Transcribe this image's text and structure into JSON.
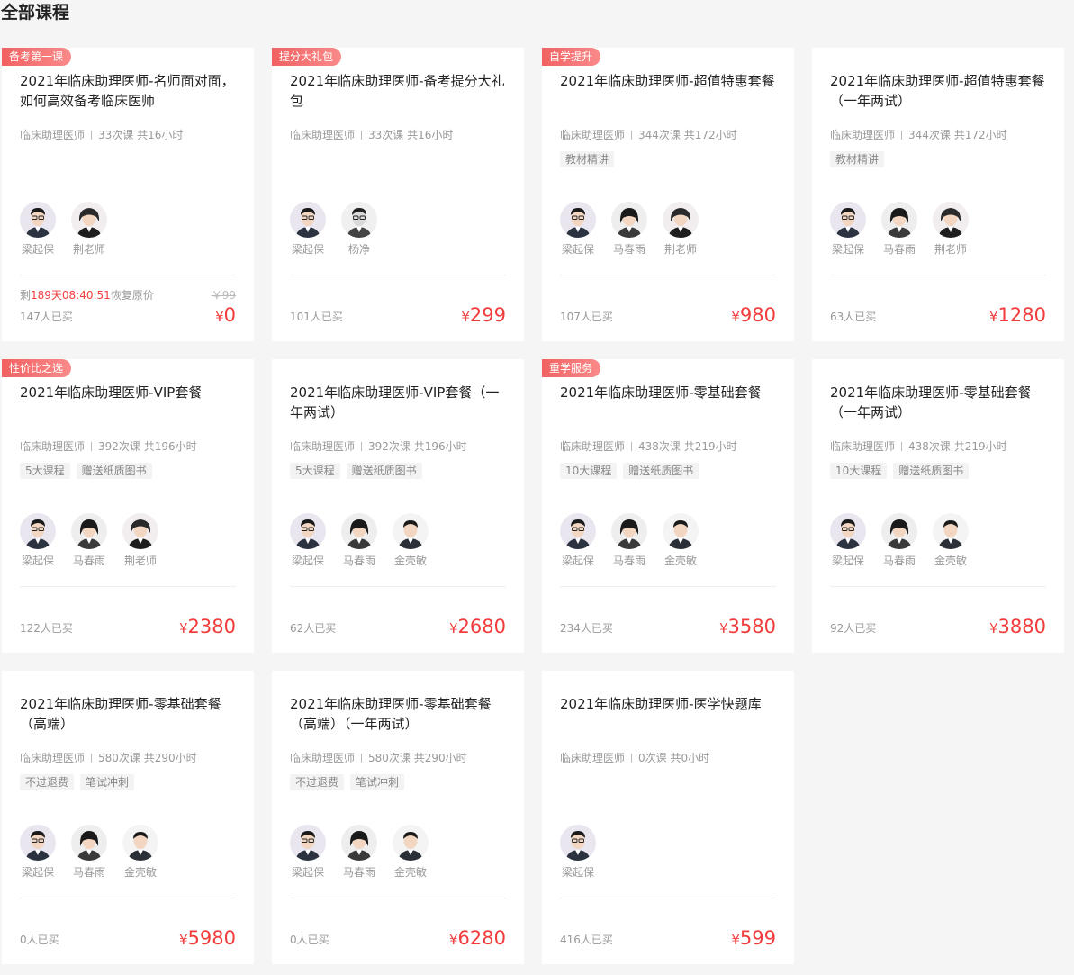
{
  "page_title": "全部课程",
  "colors": {
    "accent": "#f23c3c",
    "badge": "#f26161"
  },
  "courses": [
    {
      "badge": "备考第一课",
      "title": "2021年临床助理医师-名师面对面，如何高效备考临床医师",
      "category": "临床助理医师",
      "lessons": "33次课 共16小时",
      "tags": [],
      "teachers": [
        {
          "name": "梁起保",
          "look": "glasses"
        },
        {
          "name": "荆老师",
          "look": "woman"
        }
      ],
      "countdown": {
        "prefix": "剩",
        "days": "189天",
        "time": "08:40:51",
        "suffix": "恢复原价"
      },
      "original_price": "￥99",
      "bought": "147人已买",
      "currency": "¥",
      "price": "0"
    },
    {
      "badge": "提分大礼包",
      "title": "2021年临床助理医师-备考提分大礼包",
      "category": "临床助理医师",
      "lessons": "33次课 共16小时",
      "tags": [],
      "teachers": [
        {
          "name": "梁起保",
          "look": "glasses"
        },
        {
          "name": "杨净",
          "look": "glassesbw"
        }
      ],
      "bought": "101人已买",
      "currency": "¥",
      "price": "299"
    },
    {
      "badge": "自学提升",
      "title": "2021年临床助理医师-超值特惠套餐",
      "category": "临床助理医师",
      "lessons": "344次课 共172小时",
      "tags": [
        "教材精讲"
      ],
      "teachers": [
        {
          "name": "梁起保",
          "look": "glasses"
        },
        {
          "name": "马春雨",
          "look": "bob"
        },
        {
          "name": "荆老师",
          "look": "woman"
        }
      ],
      "bought": "107人已买",
      "currency": "¥",
      "price": "980"
    },
    {
      "badge": "",
      "title": "2021年临床助理医师-超值特惠套餐（一年两试）",
      "category": "临床助理医师",
      "lessons": "344次课 共172小时",
      "tags": [
        "教材精讲"
      ],
      "teachers": [
        {
          "name": "梁起保",
          "look": "glasses"
        },
        {
          "name": "马春雨",
          "look": "bob"
        },
        {
          "name": "荆老师",
          "look": "woman"
        }
      ],
      "bought": "63人已买",
      "currency": "¥",
      "price": "1280"
    },
    {
      "badge": "性价比之选",
      "title": "2021年临床助理医师-VIP套餐",
      "category": "临床助理医师",
      "lessons": "392次课 共196小时",
      "tags": [
        "5大课程",
        "赠送纸质图书"
      ],
      "teachers": [
        {
          "name": "梁起保",
          "look": "glasses"
        },
        {
          "name": "马春雨",
          "look": "bob"
        },
        {
          "name": "荆老师",
          "look": "woman"
        }
      ],
      "bought": "122人已买",
      "currency": "¥",
      "price": "2380"
    },
    {
      "badge": "",
      "title": "2021年临床助理医师-VIP套餐（一年两试）",
      "category": "临床助理医师",
      "lessons": "392次课 共196小时",
      "tags": [
        "5大课程",
        "赠送纸质图书"
      ],
      "teachers": [
        {
          "name": "梁起保",
          "look": "glasses"
        },
        {
          "name": "马春雨",
          "look": "bob"
        },
        {
          "name": "金壳敏",
          "look": "man"
        }
      ],
      "bought": "62人已买",
      "currency": "¥",
      "price": "2680"
    },
    {
      "badge": "重学服务",
      "title": "2021年临床助理医师-零基础套餐",
      "category": "临床助理医师",
      "lessons": "438次课 共219小时",
      "tags": [
        "10大课程",
        "赠送纸质图书"
      ],
      "teachers": [
        {
          "name": "梁起保",
          "look": "glasses"
        },
        {
          "name": "马春雨",
          "look": "bob"
        },
        {
          "name": "金壳敏",
          "look": "man"
        }
      ],
      "bought": "234人已买",
      "currency": "¥",
      "price": "3580"
    },
    {
      "badge": "",
      "title": "2021年临床助理医师-零基础套餐（一年两试）",
      "category": "临床助理医师",
      "lessons": "438次课 共219小时",
      "tags": [
        "10大课程",
        "赠送纸质图书"
      ],
      "teachers": [
        {
          "name": "梁起保",
          "look": "glasses"
        },
        {
          "name": "马春雨",
          "look": "bob"
        },
        {
          "name": "金壳敏",
          "look": "man"
        }
      ],
      "bought": "92人已买",
      "currency": "¥",
      "price": "3880"
    },
    {
      "badge": "",
      "title": "2021年临床助理医师-零基础套餐（高端）",
      "category": "临床助理医师",
      "lessons": "580次课 共290小时",
      "tags": [
        "不过退费",
        "笔试冲刺"
      ],
      "teachers": [
        {
          "name": "梁起保",
          "look": "glasses"
        },
        {
          "name": "马春雨",
          "look": "bob"
        },
        {
          "name": "金壳敏",
          "look": "man"
        }
      ],
      "bought": "0人已买",
      "currency": "¥",
      "price": "5980"
    },
    {
      "badge": "",
      "title": "2021年临床助理医师-零基础套餐（高端）（一年两试）",
      "category": "临床助理医师",
      "lessons": "580次课 共290小时",
      "tags": [
        "不过退费",
        "笔试冲刺"
      ],
      "teachers": [
        {
          "name": "梁起保",
          "look": "glasses"
        },
        {
          "name": "马春雨",
          "look": "bob"
        },
        {
          "name": "金壳敏",
          "look": "man"
        }
      ],
      "bought": "0人已买",
      "currency": "¥",
      "price": "6280"
    },
    {
      "badge": "",
      "title": "2021年临床助理医师-医学快题库",
      "category": "临床助理医师",
      "lessons": "0次课 共0小时",
      "tags": [],
      "teachers": [
        {
          "name": "梁起保",
          "look": "glasses"
        }
      ],
      "bought": "416人已买",
      "currency": "¥",
      "price": "599"
    }
  ]
}
